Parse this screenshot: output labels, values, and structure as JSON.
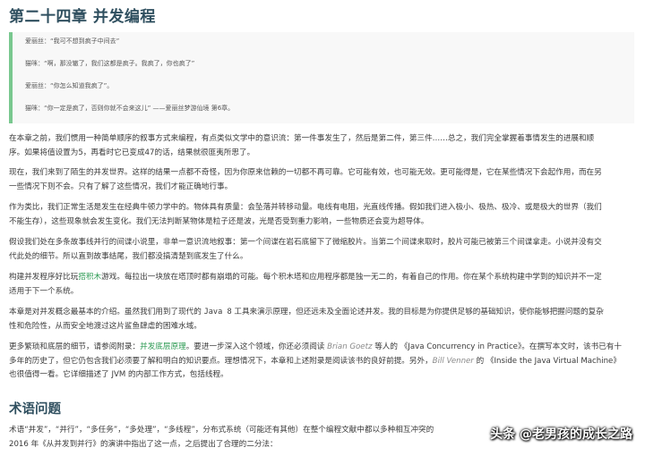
{
  "chapter_title": "第二十四章 并发编程",
  "quote_lines": [
    "爱丽丝：“我可不想到疯子中间去”",
    "猫咪：“啊，那没辙了，我们这都是疯子。我疯了，你也疯了”",
    "爱丽丝：“你怎么知道我疯了”。",
    "猫咪：“你一定是疯了，否则你就不会来这儿” ——爱丽丝梦游仙境 第6章。"
  ],
  "p1": [
    "在本章之前，我们惯用一种简单顺序的叙事方式来编程，有点类似文学中的意识流：第一件事发生了，然后是第二件，第三件……总之，我们完全掌握着事情发生的进展和顺",
    "序。如果将值设置为5，再看时它已变成47的话，结果就很匪夷所思了。"
  ],
  "p2": [
    "现在，我们来到了陌生的并发世界。这样的结果一点都不奇怪，因为你原来信赖的一切都不再可靠。它可能有效，也可能无效。更可能得是，它在某些情况下会起作用，而在另",
    "一些情况下则不会。只有了解了这些情况，我们才能正确地行事。"
  ],
  "p3": [
    "作为类比，我们正常生活是发生在经典牛顿力学中的。物体具有质量：会坠落并转移动量。电线有电阻，光直线传播。假如我们进入极小、极热、极冷、或是极大的世界（我们",
    "不能生存），这些现象就会发生变化。我们无法判断某物体是粒子还是波，光是否受到重力影响，一些物质还会变为超导体。"
  ],
  "p4": [
    "假设我们处在多条故事线并行的间谍小说里，非单一意识流地叙事：第一个间谍在岩石底留下了微缩胶片。当第二个间谍来取时，胶片可能已被第三个间谍拿走。小说并没有交",
    "代此处的细节。所以直到故事结尾，我们都没搞清楚到底发生了什么。"
  ],
  "p5": {
    "l1_a": "构建并发程序好比玩",
    "l1_link": "搭积木",
    "l1_b": "游戏。每拉出一块放在塔顶时都有崩塌的可能。每个积木塔和应用程序都是独一无二的，有着自己的作用。你在某个系统构建中学到的知识并不一定",
    "l2": "适用于下一个系统。"
  },
  "p6": {
    "l1_a": "本章是对并发概念最基本的介绍。虽然我们用到了现代的 ",
    "l1_code": "Java 8",
    "l1_b": " 工具来演示原理，但还远未及全面论述并发。我的目标是为你提供足够的基础知识，使你能够把握问题的复杂",
    "l2": "性和危险性，从而安全地渡过这片鲨鱼肆虐的困难水域。"
  },
  "p7": {
    "l1_a": "更多繁琐和底层的细节，请参阅附录：",
    "l1_link": "并发底层原理",
    "l1_b": "。要进一步深入这个领域，你还必须阅读 ",
    "l1_author1": "Brian Goetz",
    "l1_c": " 等人的 《Java Concurrency in Practice》。在撰写本文时，该书已有十",
    "l2_a": "多年的历史了，但它仍包含我们必须要了解和明白的知识要点。理想情况下，本章和上述附录是阅读该书的良好前提。另外，",
    "l2_author2": "Bill Venner",
    "l2_b": " 的 《Inside the Java Virtual Machine》",
    "l3": "也很值得一看。它详细描述了 JVM 的内部工作方式，包括线程。"
  },
  "section_title": "术语问题",
  "p8": [
    "术语“并发”，“并行”，“多任务”，“多处理”，“多线程”，分布式系统（可能还有其他）在整个编程文献中都以多种相互冲突的",
    "2016 年《从并发到并行》的演讲中指出了这一点，之后提出了合理的二分法："
  ],
  "watermark": "头条 @老男孩的成长之路"
}
